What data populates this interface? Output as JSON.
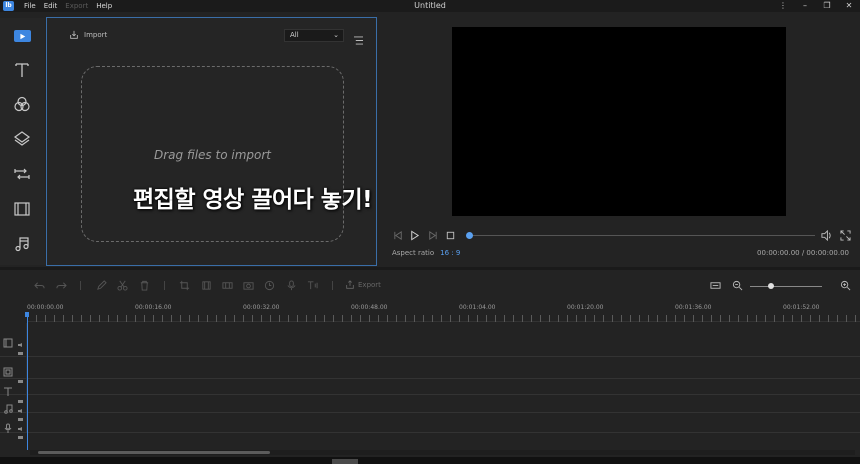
{
  "titlebar": {
    "logo_text": "lb",
    "menu": [
      {
        "label": "File",
        "enabled": true
      },
      {
        "label": "Edit",
        "enabled": true
      },
      {
        "label": "Export",
        "enabled": false
      },
      {
        "label": "Help",
        "enabled": true
      }
    ],
    "title": "Untitled",
    "controls": [
      "more-icon",
      "minimize-icon",
      "restore-icon",
      "close-icon"
    ]
  },
  "rail": {
    "items": [
      {
        "name": "media",
        "icon": "media-icon",
        "active": true
      },
      {
        "name": "text",
        "icon": "text-icon"
      },
      {
        "name": "filters",
        "icon": "filters-icon"
      },
      {
        "name": "overlays",
        "icon": "overlays-icon"
      },
      {
        "name": "transitions",
        "icon": "transitions-icon"
      },
      {
        "name": "elements",
        "icon": "film-icon"
      },
      {
        "name": "music",
        "icon": "music-icon"
      }
    ]
  },
  "media": {
    "import_label": "Import",
    "filter_value": "All",
    "drop_text": "Drag files to import"
  },
  "overlay_caption": "편집할 영상 끌어다 놓기!",
  "preview": {
    "progress": 0,
    "aspect_label": "Aspect ratio",
    "aspect_value": "16 : 9",
    "timecode": "00:00:00.00 / 00:00:00.00"
  },
  "timeline": {
    "export_label": "Export",
    "ruler": [
      "00:00:00.00",
      "00:00:16.00",
      "00:00:32.00",
      "00:00:48.00",
      "00:01:04.00",
      "00:01:20.00",
      "00:01:36.00",
      "00:01:52.00"
    ],
    "tracks": [
      {
        "type": "video",
        "icon": "video-track-icon"
      },
      {
        "type": "overlay",
        "icon": "overlay-track-icon"
      },
      {
        "type": "text",
        "icon": "text-track-icon"
      },
      {
        "type": "music",
        "icon": "music-track-icon"
      },
      {
        "type": "voice",
        "icon": "mic-track-icon"
      }
    ]
  },
  "colors": {
    "accent": "#3d86e0",
    "background": "#232323",
    "video": "#000000"
  }
}
